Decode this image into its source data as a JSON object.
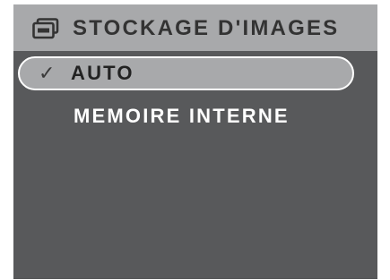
{
  "menu": {
    "title": "STOCKAGE D'IMAGES",
    "title_icon": "image-storage-icon",
    "items": [
      {
        "label": "AUTO",
        "selected": true,
        "check_mark": "✓"
      },
      {
        "label": "MEMOIRE INTERNE",
        "selected": false
      }
    ]
  },
  "colors": {
    "screen_background": "#58595b",
    "header_background": "#a8a9ab",
    "selected_background": "#a8a9ab",
    "selected_border": "#ffffff",
    "unselected_text": "#ffffff"
  }
}
